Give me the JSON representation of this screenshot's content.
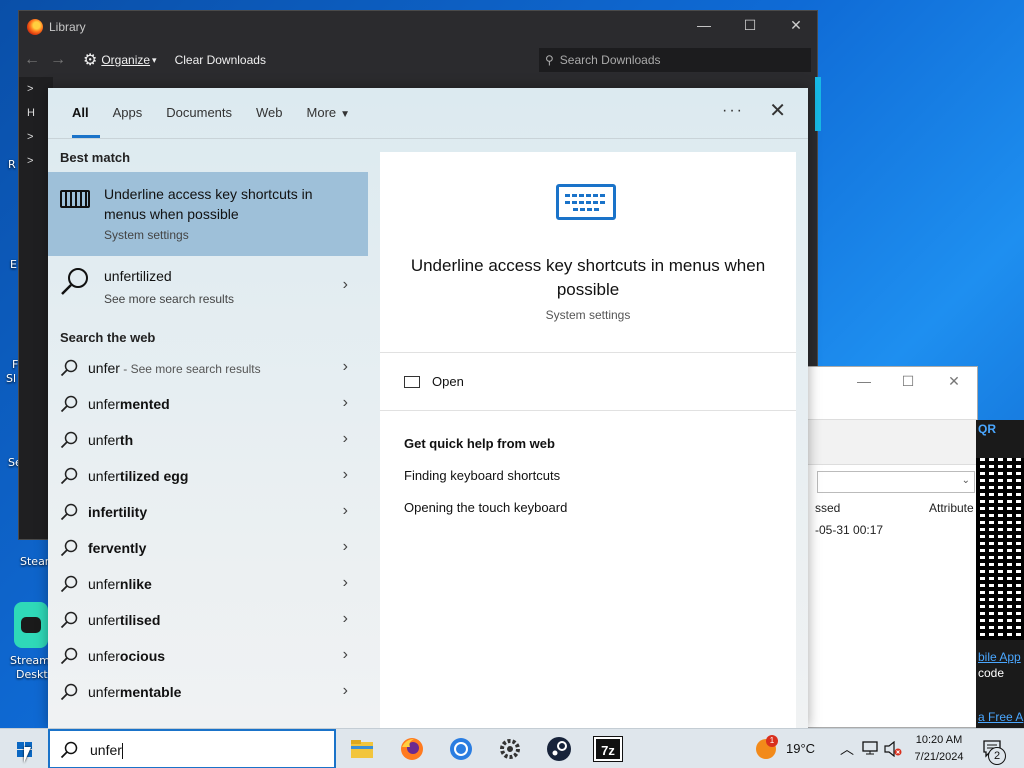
{
  "desktop": {
    "labels": [
      "R",
      "E",
      "F",
      "Sl",
      "Se",
      "Steam",
      "Stream",
      "Deskt"
    ]
  },
  "library": {
    "title": "Library",
    "organize_label": "Organize",
    "clear_downloads_label": "Clear Downloads",
    "search_placeholder": "Search Downloads",
    "sidebar_items": [
      ">",
      "H",
      "⋮",
      ">",
      ">"
    ],
    "history_partial": "Histo"
  },
  "background_window": {
    "col_accessed": "ssed",
    "col_attributes": "Attribute",
    "date_value": "-05-31 00:17"
  },
  "qr_panel": {
    "top_label": "QR",
    "mobile_app_link": "bile App",
    "code_text": "code",
    "free_link": "a Free A"
  },
  "search_panel": {
    "tabs": [
      {
        "label": "All",
        "active": true
      },
      {
        "label": "Apps",
        "active": false
      },
      {
        "label": "Documents",
        "active": false
      },
      {
        "label": "Web",
        "active": false
      },
      {
        "label": "More",
        "active": false
      }
    ],
    "more_options": "···",
    "best_match_heading": "Best match",
    "best_match": {
      "title": "Underline access key shortcuts in menus when possible",
      "subtitle": "System settings"
    },
    "unfertilized": {
      "title": "unfertilized",
      "subtitle": "See more search results"
    },
    "search_web_heading": "Search the web",
    "web_results": [
      {
        "prefix": "unfer",
        "bold": "",
        "extra": " - See more search results"
      },
      {
        "prefix": "unfer",
        "bold": "mented",
        "extra": ""
      },
      {
        "prefix": "unfer",
        "bold": "th",
        "extra": ""
      },
      {
        "prefix": "unfer",
        "bold": "tilized egg",
        "extra": ""
      },
      {
        "prefix": "",
        "bold": "infertility",
        "extra": ""
      },
      {
        "prefix": "",
        "bold": "fervently",
        "extra": ""
      },
      {
        "prefix": "unfer",
        "bold": "nlike",
        "extra": ""
      },
      {
        "prefix": "unfer",
        "bold": "tilised",
        "extra": ""
      },
      {
        "prefix": "unfer",
        "bold": "ocious",
        "extra": ""
      },
      {
        "prefix": "unfer",
        "bold": "mentable",
        "extra": ""
      }
    ],
    "preview": {
      "title": "Underline access key shortcuts in menus when possible",
      "subtitle": "System settings",
      "open_label": "Open",
      "quick_help_heading": "Get quick help from web",
      "links": [
        "Finding keyboard shortcuts",
        "Opening the touch keyboard"
      ]
    }
  },
  "taskbar": {
    "search_value": "unfer",
    "weather_temp": "19°C",
    "weather_badge": "1",
    "time": "10:20 AM",
    "date": "7/21/2024",
    "notification_count": "2",
    "seven_zip_label": "7z"
  },
  "colors": {
    "accent": "#1a73c9",
    "best_match_bg": "#9ec0d9",
    "taskbar_bg": "#dfe6ec"
  }
}
